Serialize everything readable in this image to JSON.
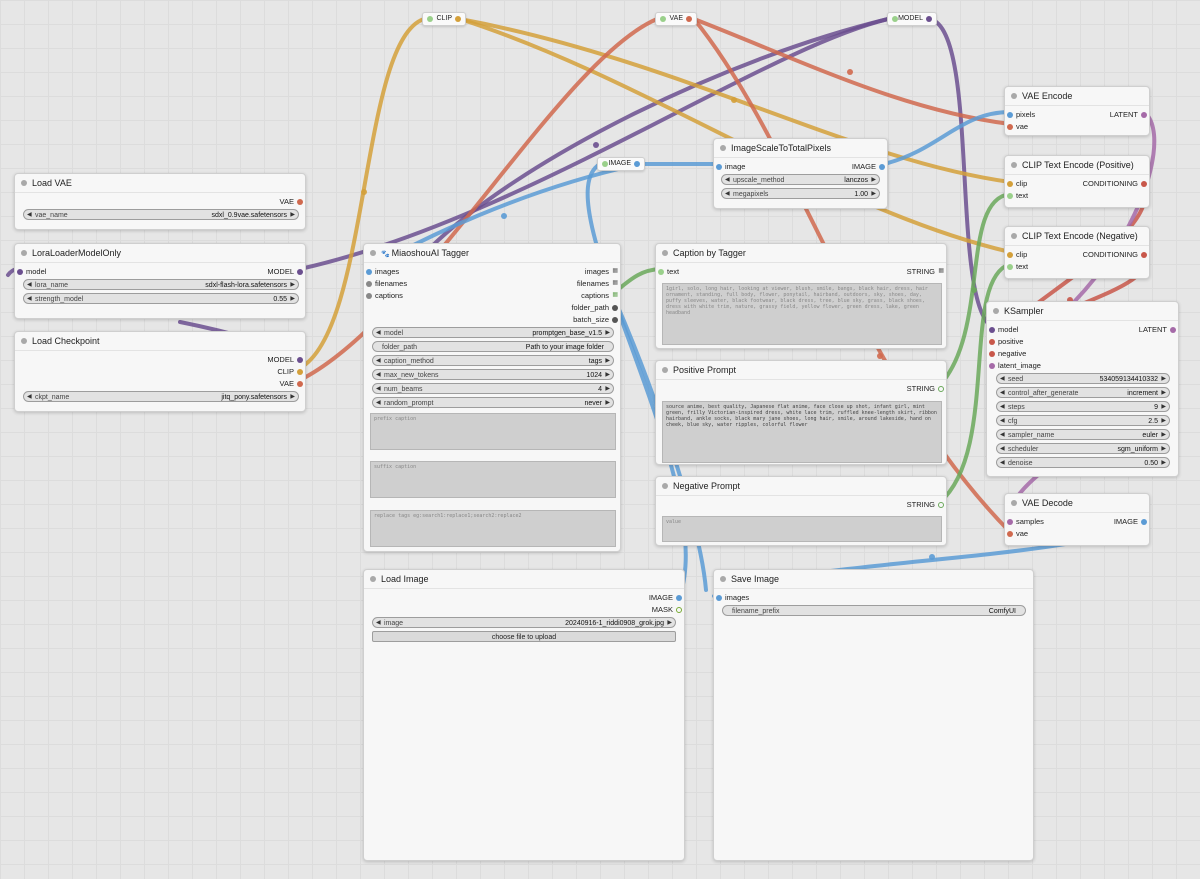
{
  "colors": {
    "model": "#6b4f8f",
    "clip": "#d4a03a",
    "vae": "#d0694e",
    "image": "#5b9bd5",
    "string": "#6aa85a",
    "latent": "#a56aa8",
    "conditioning": "#c8574a",
    "mask": "#77aa33"
  },
  "reroutes": {
    "clip": {
      "label": "CLIP"
    },
    "vae": {
      "label": "VAE"
    },
    "model": {
      "label": "MODEL"
    },
    "image": {
      "label": "IMAGE"
    }
  },
  "load_vae": {
    "title": "Load VAE",
    "out_vae": "VAE",
    "vae_name_label": "vae_name",
    "vae_name_value": "sdxl_0.9vae.safetensors"
  },
  "lora_loader": {
    "title": "LoraLoaderModelOnly",
    "in_model": "model",
    "out_model": "MODEL",
    "lora_name_label": "lora_name",
    "lora_name_value": "sdxl-flash-lora.safetensors",
    "strength_label": "strength_model",
    "strength_value": "0.55"
  },
  "load_checkpoint": {
    "title": "Load Checkpoint",
    "out_model": "MODEL",
    "out_clip": "CLIP",
    "out_vae": "VAE",
    "ckpt_label": "ckpt_name",
    "ckpt_value": "jitq_pony.safetensors"
  },
  "tagger": {
    "title": "MiaoshouAI Tagger",
    "in_images": "images",
    "in_filenames": "filenames",
    "in_captions": "captions",
    "out_images": "images",
    "out_filenames": "filenames",
    "out_captions": "captions",
    "out_folder_path": "folder_path",
    "out_batch_size": "batch_size",
    "model_label": "model",
    "model_value": "promptgen_base_v1.5",
    "folder_label": "folder_path",
    "folder_value": "Path to your image folder",
    "caption_method_label": "caption_method",
    "caption_method_value": "tags",
    "max_tokens_label": "max_new_tokens",
    "max_tokens_value": "1024",
    "num_beams_label": "num_beams",
    "num_beams_value": "4",
    "random_prompt_label": "random_prompt",
    "random_prompt_value": "never",
    "prefix_placeholder": "prefix caption",
    "suffix_placeholder": "suffix caption",
    "replace_placeholder": "replace tags eg:search1:replace1;search2:replace2"
  },
  "caption_by_tagger": {
    "title": "Caption by Tagger",
    "in_text": "text",
    "out_string": "STRING",
    "text": "1girl, solo, long hair, looking at viewer, blush, smile, bangs, black hair, dress, hair ornament, standing, full body, flower, ponytail, hairband, outdoors, sky, shoes, day, puffy sleeves, water, black footwear, black dress, tree, blue sky, grass, black shoes, dress with white trim, nature, grassy field, yellow flower, green dress, lake, green headband"
  },
  "positive_prompt": {
    "title": "Positive Prompt",
    "out_string": "STRING",
    "text": "source anime, best quality, Japanese flat anime, face close up shot, infant girl, mint green, frilly Victorian-inspired dress, white lace trim, ruffled knee-length skirt, ribbon hairband, ankle socks, black mary jane shoes, long hair, smile, around lakeside, hand on cheek, blue sky, water ripples, colorful flower"
  },
  "negative_prompt": {
    "title": "Negative Prompt",
    "out_string": "STRING",
    "placeholder": "value"
  },
  "image_scale": {
    "title": "ImageScaleToTotalPixels",
    "in_image": "image",
    "out_image": "IMAGE",
    "upscale_label": "upscale_method",
    "upscale_value": "lanczos",
    "megapixels_label": "megapixels",
    "megapixels_value": "1.00"
  },
  "vae_encode": {
    "title": "VAE Encode",
    "in_pixels": "pixels",
    "in_vae": "vae",
    "out_latent": "LATENT"
  },
  "clip_pos": {
    "title": "CLIP Text Encode (Positive)",
    "in_clip": "clip",
    "in_text": "text",
    "out_cond": "CONDITIONING"
  },
  "clip_neg": {
    "title": "CLIP Text Encode (Negative)",
    "in_clip": "clip",
    "in_text": "text",
    "out_cond": "CONDITIONING"
  },
  "ksampler": {
    "title": "KSampler",
    "in_model": "model",
    "in_positive": "positive",
    "in_negative": "negative",
    "in_latent": "latent_image",
    "out_latent": "LATENT",
    "seed_label": "seed",
    "seed_value": "534059134410332",
    "control_label": "control_after_generate",
    "control_value": "increment",
    "steps_label": "steps",
    "steps_value": "9",
    "cfg_label": "cfg",
    "cfg_value": "2.5",
    "sampler_label": "sampler_name",
    "sampler_value": "euler",
    "scheduler_label": "scheduler",
    "scheduler_value": "sgm_uniform",
    "denoise_label": "denoise",
    "denoise_value": "0.50"
  },
  "vae_decode": {
    "title": "VAE Decode",
    "in_samples": "samples",
    "in_vae": "vae",
    "out_image": "IMAGE"
  },
  "load_image": {
    "title": "Load Image",
    "out_image": "IMAGE",
    "out_mask": "MASK",
    "image_label": "image",
    "image_value": "20240916-1_riddi0908_grok.jpg",
    "upload_label": "choose file to upload"
  },
  "save_image": {
    "title": "Save Image",
    "in_images": "images",
    "prefix_label": "filename_prefix",
    "prefix_value": "ComfyUI"
  }
}
